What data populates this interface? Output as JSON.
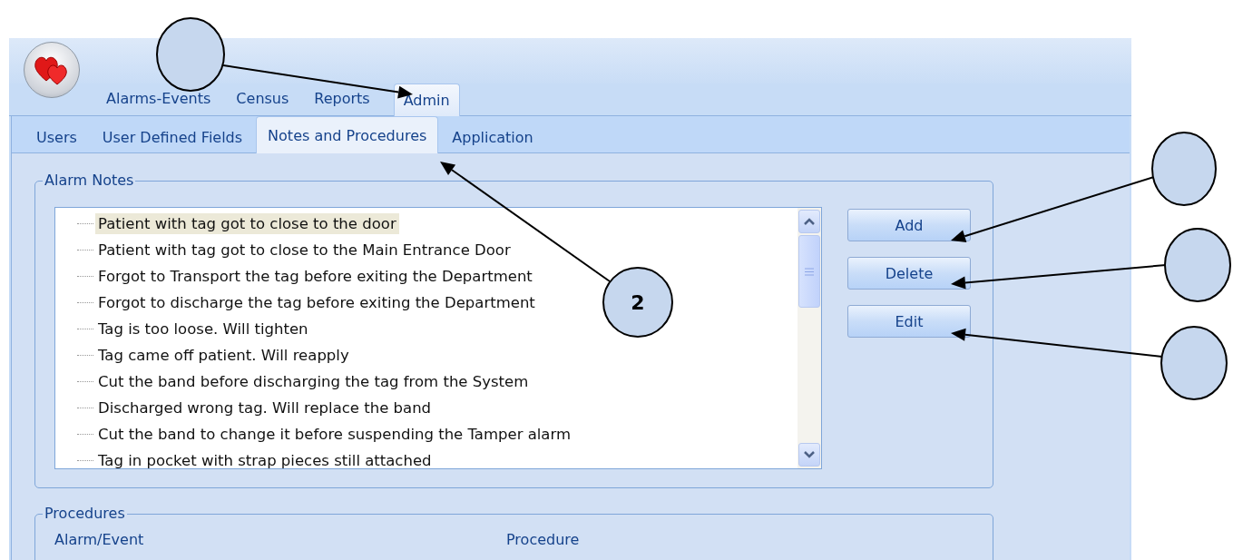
{
  "ribbon_tabs": [
    {
      "label": "Alarms-Events",
      "selected": false
    },
    {
      "label": "Census",
      "selected": false
    },
    {
      "label": "Reports",
      "selected": false
    },
    {
      "label": "Admin",
      "selected": true
    }
  ],
  "sub_tabs": [
    {
      "label": "Users",
      "selected": false
    },
    {
      "label": "User Defined Fields",
      "selected": false
    },
    {
      "label": "Notes and Procedures",
      "selected": true
    },
    {
      "label": "Application",
      "selected": false
    }
  ],
  "alarm_notes": {
    "title": "Alarm Notes",
    "items": [
      {
        "text": "Patient with tag got to close to the door",
        "selected": true
      },
      {
        "text": "Patient with tag got to close to the Main Entrance Door",
        "selected": false
      },
      {
        "text": "Forgot to Transport the tag before exiting the Department",
        "selected": false
      },
      {
        "text": "Forgot to discharge the tag before exiting the Department",
        "selected": false
      },
      {
        "text": "Tag is too loose. Will tighten",
        "selected": false
      },
      {
        "text": "Tag came off patient. Will reapply",
        "selected": false
      },
      {
        "text": "Cut the band before discharging the tag from the System",
        "selected": false
      },
      {
        "text": "Discharged wrong tag. Will replace the band",
        "selected": false
      },
      {
        "text": "Cut the band to change it before suspending the Tamper alarm",
        "selected": false
      },
      {
        "text": "Tag in pocket with strap pieces still attached",
        "selected": false
      }
    ]
  },
  "buttons": [
    "Add",
    "Delete",
    "Edit"
  ],
  "procedures": {
    "title": "Procedures",
    "columns": [
      "Alarm/Event",
      "Procedure"
    ]
  },
  "callouts": [
    {
      "kind": "cut"
    },
    {
      "kind": "number",
      "label": "2"
    },
    {
      "kind": "cut"
    },
    {
      "kind": "cut"
    },
    {
      "kind": "cut"
    }
  ]
}
